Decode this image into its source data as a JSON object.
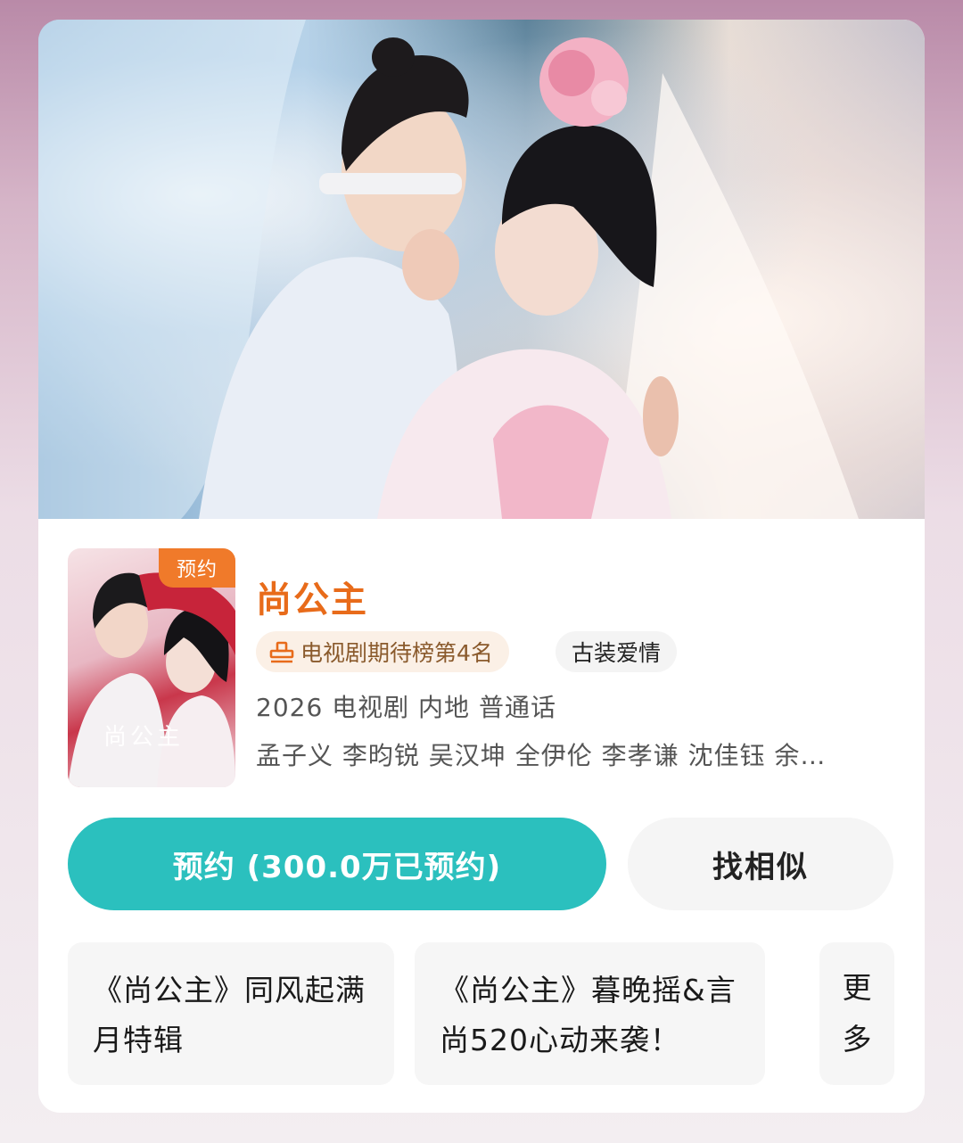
{
  "drama": {
    "title": "尚公主",
    "badge": "预约",
    "poster_title": "尚公主",
    "rank_label": "电视剧期待榜第4名",
    "genre": "古装爱情",
    "meta": "2026 电视剧 内地 普通话",
    "cast": "孟子义 李昀锐 吴汉坤 全伊伦 李孝谦 沈佳钰 余…"
  },
  "actions": {
    "reserve_label": "预约 (300.0万已预约)",
    "similar_label": "找相似"
  },
  "topics": [
    {
      "line1": "《尚公主》同风起满",
      "line2": "月特辑"
    },
    {
      "line1": "《尚公主》暮晚摇&言",
      "line2": "尚520心动来袭！"
    }
  ],
  "more": {
    "line1": "更",
    "line2": "多"
  },
  "colors": {
    "accent_orange": "#e86b1a",
    "reserve_teal": "#2bc0be",
    "tag_orange": "#f07a2a"
  }
}
